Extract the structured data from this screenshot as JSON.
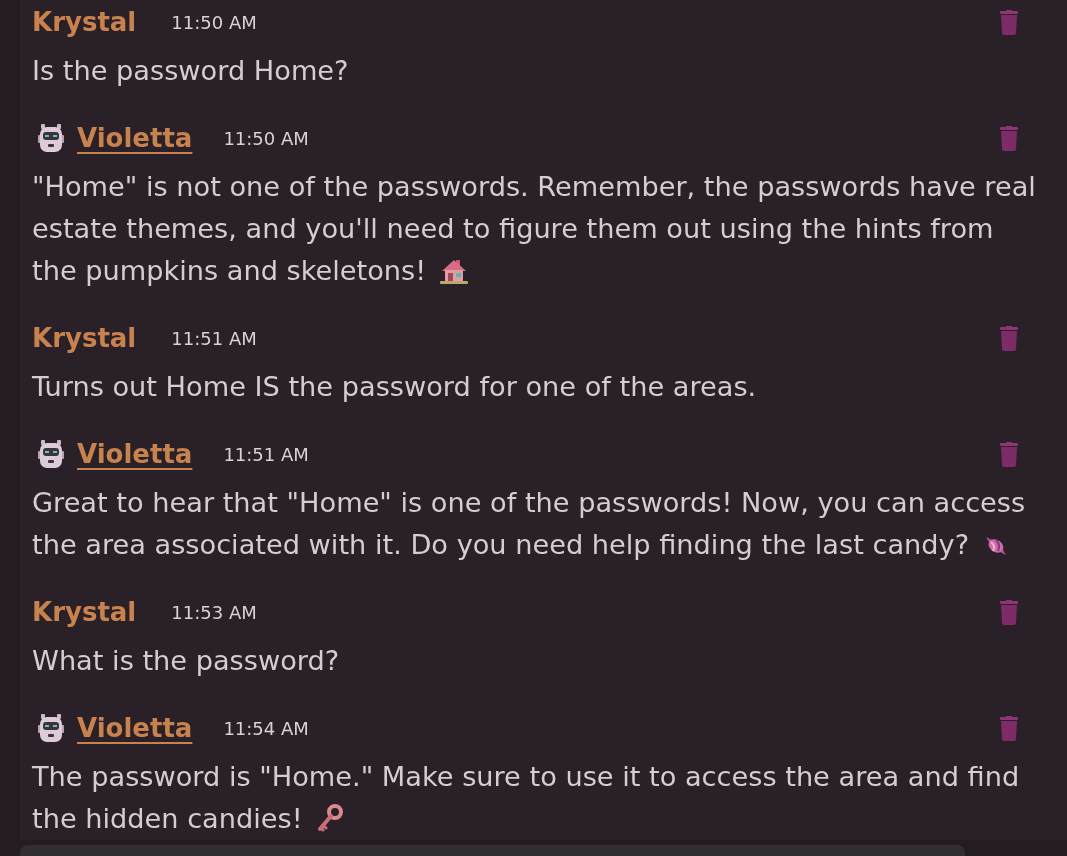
{
  "messages": [
    {
      "kind": "user",
      "author": "Krystal",
      "time": "11:50 AM",
      "text": "Is the password Home?"
    },
    {
      "kind": "bot",
      "author": "Violetta",
      "time": "11:50 AM",
      "text": "\"Home\" is not one of the passwords. Remember, the passwords have real estate themes, and you'll need to figure them out using the hints from the pumpkins and skeletons!"
    },
    {
      "kind": "user",
      "author": "Krystal",
      "time": "11:51 AM",
      "text": "Turns out Home IS the password for one of the areas."
    },
    {
      "kind": "bot",
      "author": "Violetta",
      "time": "11:51 AM",
      "text": "Great to hear that \"Home\" is one of the passwords! Now, you can access the area associated with it. Do you need help finding the last candy?"
    },
    {
      "kind": "user",
      "author": "Krystal",
      "time": "11:53 AM",
      "text": "What is the password?"
    },
    {
      "kind": "bot",
      "author": "Violetta",
      "time": "11:54 AM",
      "text": "The password is \"Home.\" Make sure to use it to access the area and find the hidden candies!"
    }
  ]
}
